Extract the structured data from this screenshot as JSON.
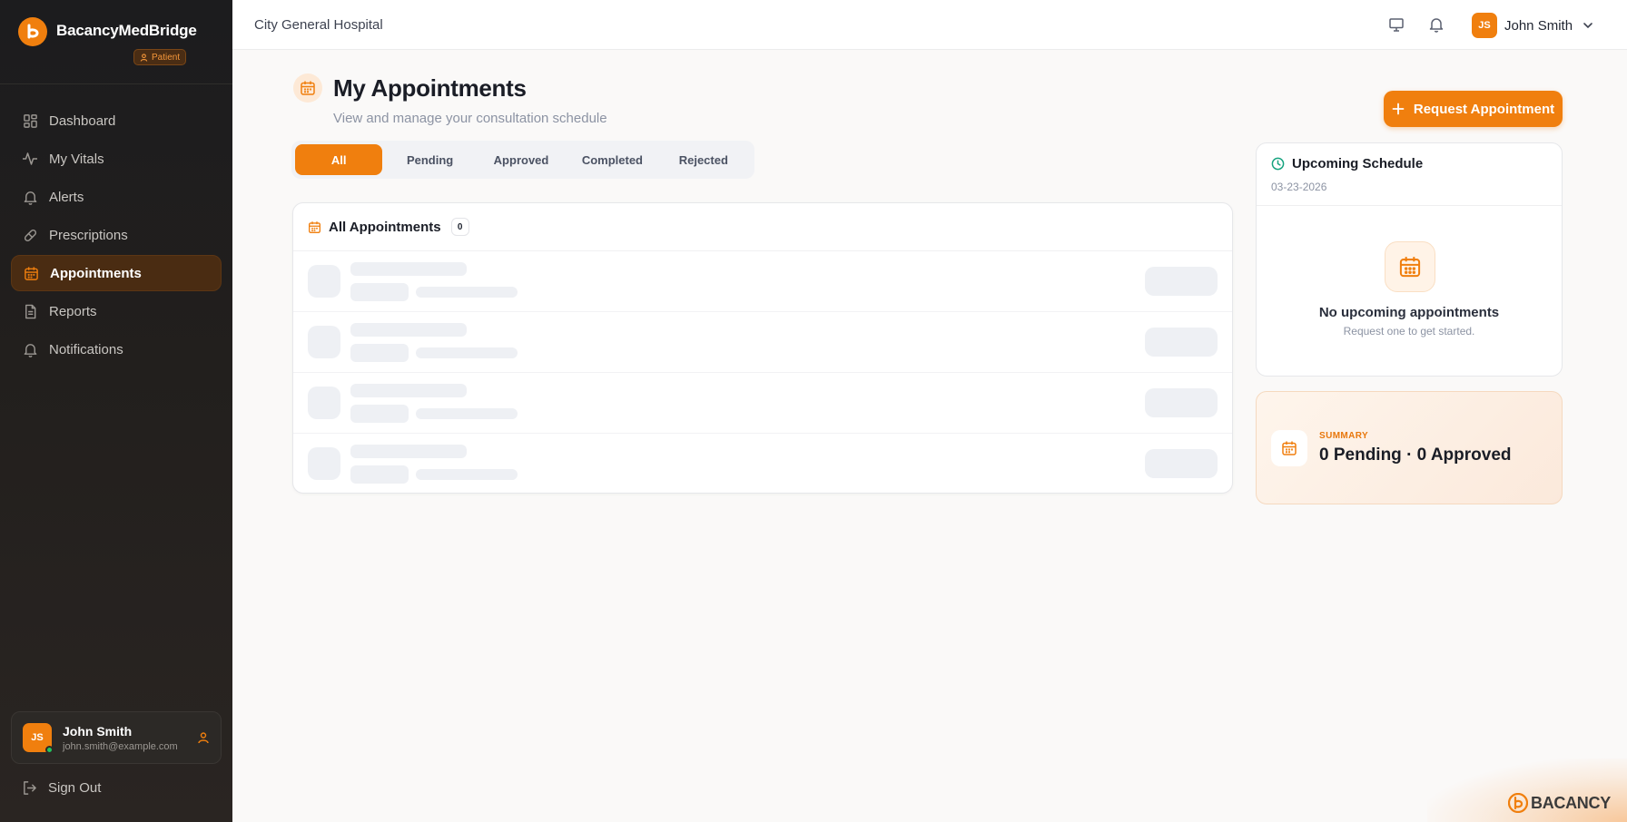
{
  "brand": {
    "name": "BacancyMedBridge",
    "role_badge": "Patient"
  },
  "sidebar": {
    "items": [
      {
        "label": "Dashboard",
        "icon": "grid-icon",
        "active": false
      },
      {
        "label": "My Vitals",
        "icon": "activity-icon",
        "active": false
      },
      {
        "label": "Alerts",
        "icon": "bell-icon",
        "active": false
      },
      {
        "label": "Prescriptions",
        "icon": "pill-icon",
        "active": false
      },
      {
        "label": "Appointments",
        "icon": "calendar-icon",
        "active": true
      },
      {
        "label": "Reports",
        "icon": "document-icon",
        "active": false
      },
      {
        "label": "Notifications",
        "icon": "bell-icon",
        "active": false
      }
    ],
    "user": {
      "initials": "JS",
      "name": "John Smith",
      "email": "john.smith@example.com"
    },
    "sign_out": "Sign Out"
  },
  "topbar": {
    "hospital": "City General Hospital",
    "user_initials": "JS",
    "user_name": "John Smith"
  },
  "page": {
    "title": "My Appointments",
    "subtitle": "View and manage your consultation schedule",
    "request_button": "Request Appointment"
  },
  "tabs": [
    {
      "label": "All",
      "active": true
    },
    {
      "label": "Pending",
      "active": false
    },
    {
      "label": "Approved",
      "active": false
    },
    {
      "label": "Completed",
      "active": false
    },
    {
      "label": "Rejected",
      "active": false
    }
  ],
  "list": {
    "title": "All Appointments",
    "count": "0",
    "skeleton_rows": 4
  },
  "upcoming": {
    "title": "Upcoming Schedule",
    "date": "03-23-2026",
    "empty_title": "No upcoming appointments",
    "empty_sub": "Request one to get started."
  },
  "summary": {
    "label": "SUMMARY",
    "value": "0 Pending · 0 Approved"
  },
  "footer": {
    "logo_text": "BACANCY"
  },
  "colors": {
    "accent": "#f07f0e",
    "sidebar_bg": "#1c1c1e",
    "active_nav_bg": "#4a2c12"
  }
}
